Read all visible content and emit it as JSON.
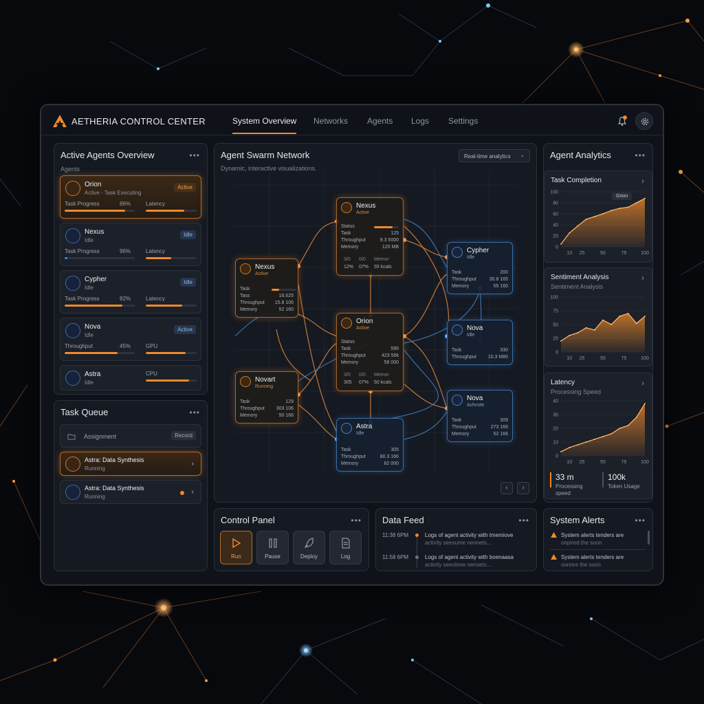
{
  "app": {
    "brand": "AETHERIA CONTROL CENTER",
    "nav": [
      "System Overview",
      "Networks",
      "Agents",
      "Logs",
      "Settings"
    ],
    "active_nav": "System Overview"
  },
  "agents_panel": {
    "title": "Active Agents Overview",
    "subtitle": "Agents",
    "cards": [
      {
        "name": "Orion",
        "status": "Active · Task Executing",
        "badge": "Active",
        "m1": "Task Progress",
        "p1": "86%",
        "v1": 0.86,
        "m2": "Latency",
        "v2": 0.75
      },
      {
        "name": "Nexus",
        "status": "Idle",
        "badge": "Idle",
        "m1": "Task Progress",
        "p1": "96%",
        "v1": 0.04,
        "m2": "Latency",
        "v2": 0.5
      },
      {
        "name": "Cypher",
        "status": "Idle",
        "badge": "Idle",
        "m1": "Task Progress",
        "p1": "82%",
        "v1": 0.82,
        "m2": "Latency",
        "v2": 0.72
      },
      {
        "name": "Nova",
        "status": "Idle",
        "badge": "Active",
        "m1": "Throughput",
        "p1": "45%",
        "v1": 0.75,
        "m2": "GPU",
        "v2": 0.78
      },
      {
        "name": "Astra",
        "status": "Idle",
        "m2": "CPU",
        "v2": 0.85
      }
    ]
  },
  "task_queue": {
    "title": "Task Queue",
    "header_label": "Assignment",
    "header_btn": "Record",
    "items": [
      {
        "name": "Astra: Data Synthesis",
        "status": "Running"
      },
      {
        "name": "Astra: Data Synthesis",
        "status": "Running"
      }
    ]
  },
  "network": {
    "title": "Agent Swarm Network",
    "subtitle": "Dynamic, interactive visualizations.",
    "dropdown": "Real-time analytics",
    "nodes": [
      {
        "name": "Nexus",
        "status": "Active",
        "rows": [
          [
            "Status",
            ""
          ],
          [
            "Task",
            "125"
          ],
          [
            "Throughput",
            "9.3 5000"
          ],
          [
            "Memory",
            "120 MB"
          ]
        ],
        "foot": [
          "12%",
          "07%",
          "55 kcals"
        ],
        "foot_h": [
          "3/0",
          "0/0",
          "Memor"
        ]
      },
      {
        "name": "Nexus",
        "status": "Active",
        "rows": [
          [
            "Task",
            "16.625"
          ],
          [
            "Tass",
            "16.625"
          ],
          [
            "Throughput",
            "15.8 106"
          ],
          [
            "Memory",
            "52 160"
          ]
        ]
      },
      {
        "name": "Orion",
        "status": "Active",
        "rows": [
          [
            "Status",
            ""
          ],
          [
            "Task",
            "595"
          ],
          [
            "Throughput",
            "423 56k"
          ],
          [
            "Memory",
            "58 000"
          ]
        ],
        "foot": [
          "305",
          "07%",
          "50 kcals"
        ],
        "foot_h": [
          "3/0",
          "0/0",
          "Memor"
        ]
      },
      {
        "name": "Novart",
        "status": "Running",
        "rows": [
          [
            "Task",
            "129"
          ],
          [
            "Throughput",
            "303 106"
          ],
          [
            "Memory",
            "50 166"
          ]
        ]
      },
      {
        "name": "Cypher",
        "status": "Idle",
        "rows": [
          [
            "Task",
            "200"
          ],
          [
            "Throughput",
            "30.8 165"
          ],
          [
            "Memory",
            "55 160"
          ]
        ]
      },
      {
        "name": "Nova",
        "status": "Idle",
        "rows": [
          [
            "Task",
            "330"
          ],
          [
            "Throughput",
            "10.3 M80"
          ]
        ]
      },
      {
        "name": "Nova",
        "status": "Achnste",
        "rows": [
          [
            "Task",
            "309"
          ],
          [
            "Throughput",
            "273 166"
          ],
          [
            "Memory",
            "52 166"
          ]
        ]
      },
      {
        "name": "Astra",
        "status": "Idle",
        "rows": [
          [
            "Task",
            "305"
          ],
          [
            "Throughput",
            "80.3 166"
          ],
          [
            "Memory",
            "82 000"
          ]
        ]
      }
    ]
  },
  "control": {
    "title": "Control Panel",
    "buttons": [
      "Run",
      "Pause",
      "Deploy",
      "Log"
    ]
  },
  "feed": {
    "title": "Data Feed",
    "rows": [
      {
        "time": "11:38 6PM",
        "l1": "Logs of agent activity with tmemiove",
        "l2": "activity seesume neonets..."
      },
      {
        "time": "11:58 6PM",
        "l1": "Logs of agent activity with boenaasa",
        "l2": "activity seeolone nenoets..."
      }
    ]
  },
  "analytics": {
    "title": "Agent Analytics",
    "charts": [
      {
        "title": "Task Completion",
        "subtitle": "",
        "tooltip": "Grion"
      },
      {
        "title": "Sentiment Analysis",
        "subtitle": "Sentiment Analysis"
      },
      {
        "title": "Latency",
        "subtitle": "Processing Speed"
      }
    ],
    "stats": [
      {
        "value": "33 m",
        "label": "Processing speed"
      },
      {
        "value": "100k",
        "label": "Token Usage"
      }
    ]
  },
  "alerts": {
    "title": "System Alerts",
    "rows": [
      "System alerts tenders are",
      "System alerts tenders are"
    ],
    "rows_faded": [
      "onpired the soon",
      "oonnre the soon"
    ]
  },
  "colors": {
    "accent": "#f08a2a",
    "blue": "#3a8fe0"
  },
  "chart_data": [
    {
      "type": "area",
      "title": "Task Completion",
      "x": [
        0,
        10,
        20,
        30,
        40,
        50,
        60,
        70,
        80,
        90,
        100
      ],
      "y": [
        5,
        25,
        38,
        50,
        55,
        60,
        66,
        70,
        72,
        80,
        88
      ],
      "xticks": [
        10,
        25,
        50,
        75,
        100
      ],
      "yticks": [
        0,
        20,
        40,
        60,
        80,
        100
      ],
      "ylim": [
        0,
        100
      ]
    },
    {
      "type": "area",
      "title": "Sentiment Analysis",
      "x": [
        0,
        10,
        20,
        30,
        40,
        50,
        60,
        70,
        80,
        90,
        100
      ],
      "y": [
        20,
        30,
        35,
        44,
        40,
        58,
        50,
        65,
        70,
        52,
        65
      ],
      "xticks": [
        10,
        25,
        50,
        75,
        100
      ],
      "yticks": [
        0,
        25,
        50,
        75,
        100
      ],
      "ylim": [
        0,
        100
      ]
    },
    {
      "type": "area",
      "title": "Latency",
      "x": [
        0,
        10,
        20,
        30,
        40,
        50,
        60,
        70,
        80,
        90,
        100
      ],
      "y": [
        3,
        6,
        8,
        10,
        12,
        14,
        16,
        20,
        22,
        28,
        38
      ],
      "xticks": [
        10,
        25,
        50,
        75,
        100
      ],
      "yticks": [
        0,
        10,
        20,
        30,
        40
      ],
      "ylim": [
        0,
        40
      ]
    }
  ]
}
